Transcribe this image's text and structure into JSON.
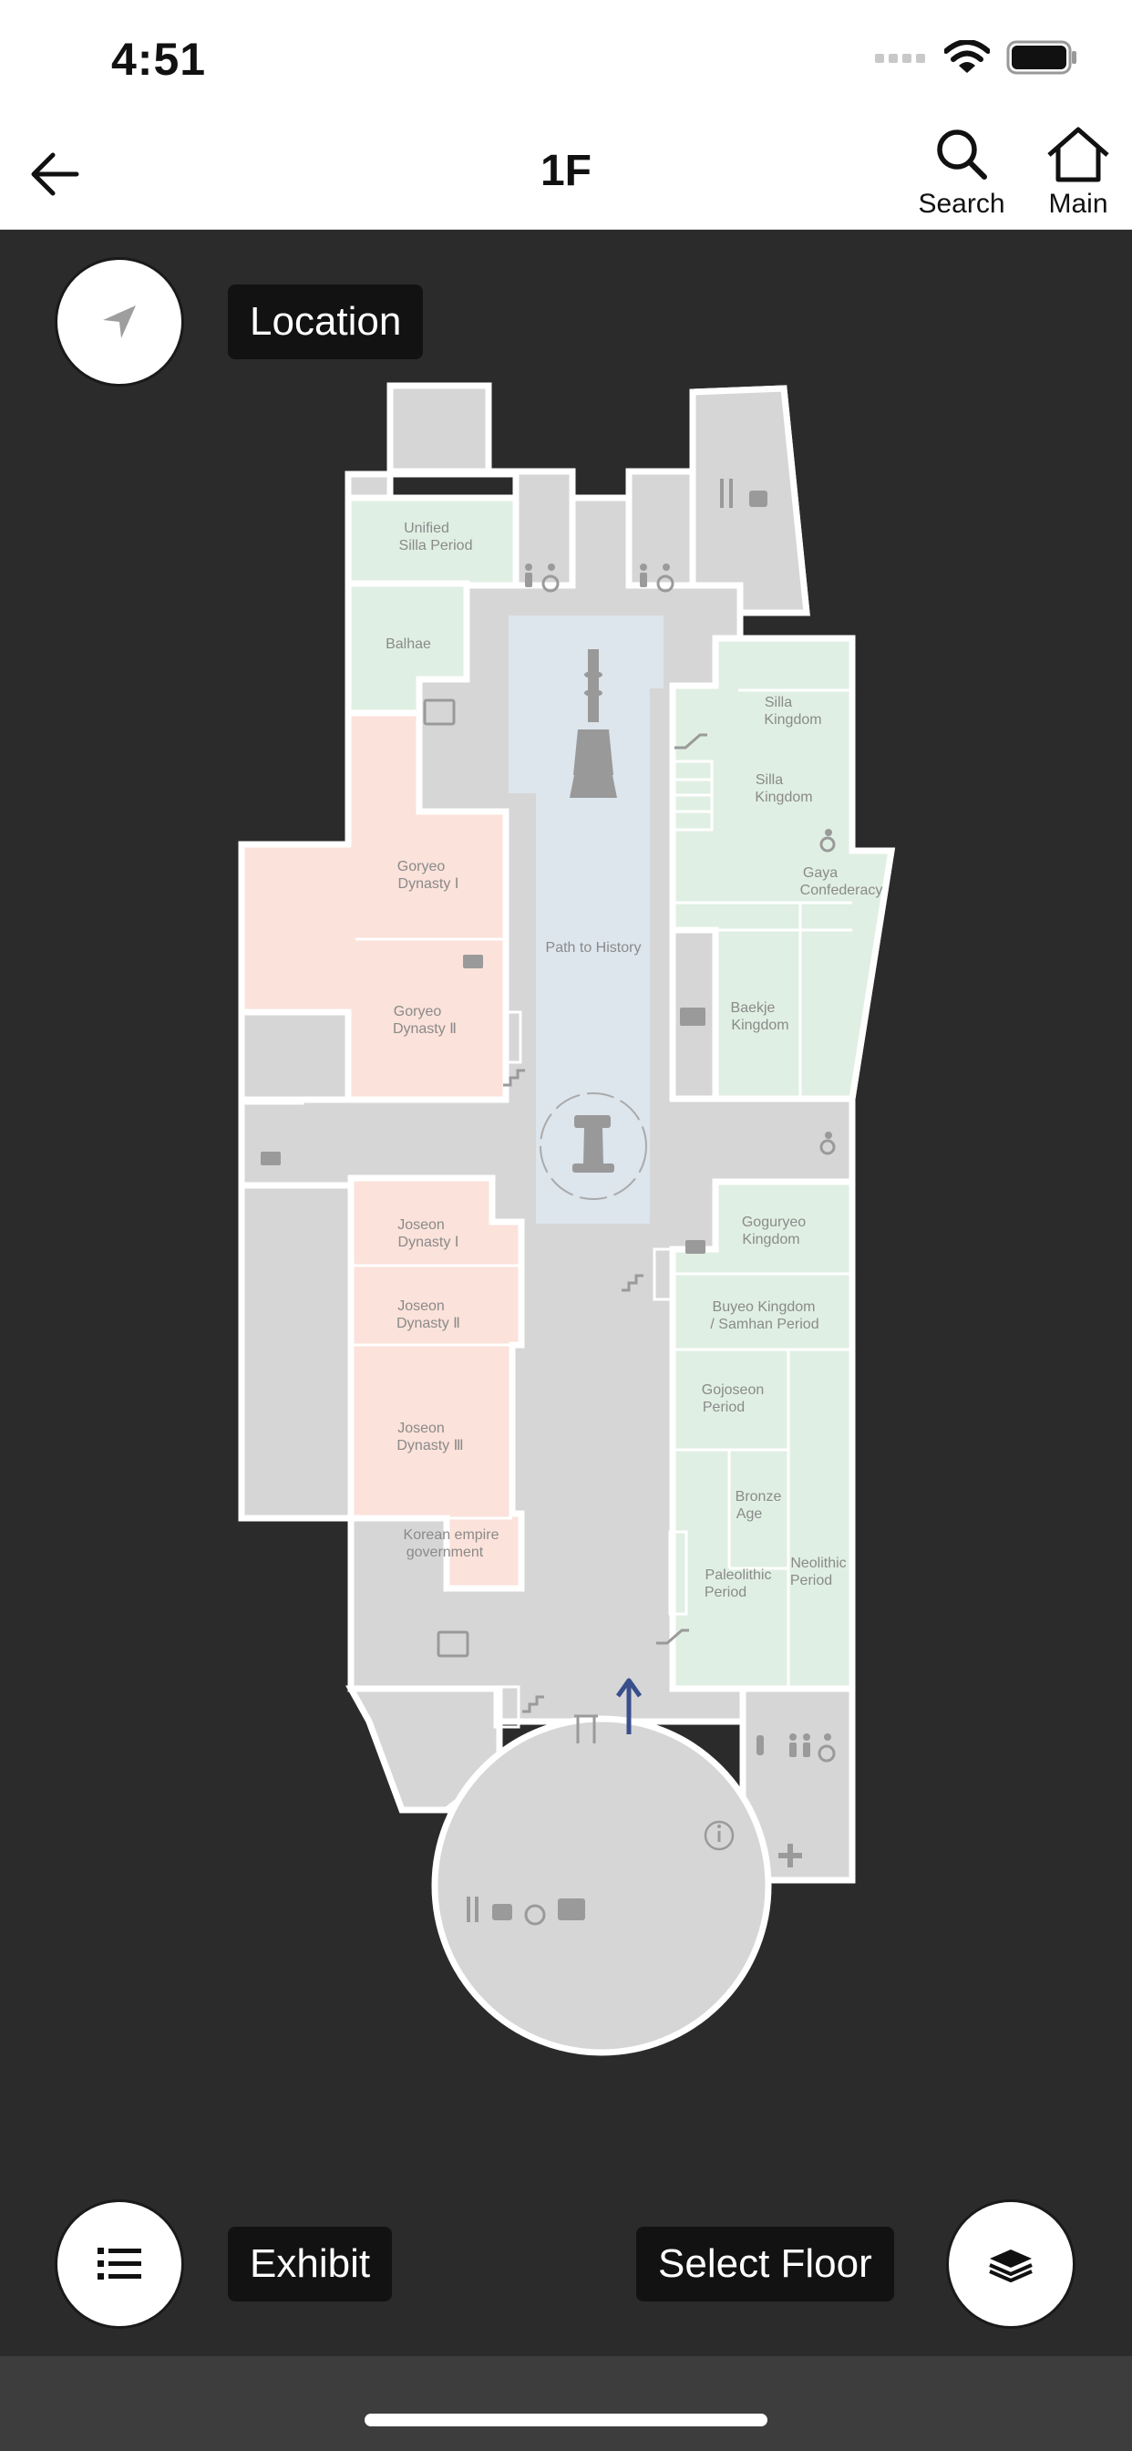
{
  "status_bar": {
    "time": "4:51"
  },
  "nav": {
    "title": "1F",
    "search_label": "Search",
    "main_label": "Main"
  },
  "controls": {
    "location_label": "Location",
    "exhibit_label": "Exhibit",
    "select_floor_label": "Select Floor"
  },
  "map": {
    "rooms": {
      "unified_silla": [
        "Unified",
        "Silla Period"
      ],
      "balhae": [
        "Balhae"
      ],
      "goryeo_1": [
        "Goryeo",
        "Dynasty Ⅰ"
      ],
      "goryeo_2": [
        "Goryeo",
        "Dynasty Ⅱ"
      ],
      "joseon_1": [
        "Joseon",
        "Dynasty Ⅰ"
      ],
      "joseon_2": [
        "Joseon",
        "Dynasty Ⅱ"
      ],
      "joseon_3": [
        "Joseon",
        "Dynasty Ⅲ"
      ],
      "korean_empire": [
        "Korean empire",
        "government"
      ],
      "path_to_history": [
        "Path to History"
      ],
      "silla_kingdom_a": [
        "Silla",
        "Kingdom"
      ],
      "silla_kingdom_b": [
        "Silla",
        "Kingdom"
      ],
      "gaya": [
        "Gaya",
        "Confederacy"
      ],
      "baekje": [
        "Baekje",
        "Kingdom"
      ],
      "goguryeo": [
        "Goguryeo",
        "Kingdom"
      ],
      "buyeo": [
        "Buyeo Kingdom",
        "/ Samhan Period"
      ],
      "gojoseon": [
        "Gojoseon",
        "Period"
      ],
      "bronze_age": [
        "Bronze",
        "Age"
      ],
      "paleolithic": [
        "Paleolithic",
        "Period"
      ],
      "neolithic": [
        "Neolithic",
        "Period"
      ]
    }
  },
  "colors": {
    "background": "#2b2b2b",
    "corridor": "#d6d6d6",
    "green_zone": "#e0efe3",
    "pink_zone": "#fbe2da",
    "blue_zone": "#dde5ed",
    "arrow": "#3a4e8c"
  },
  "icons": {
    "back": "arrow-left-icon",
    "search": "magnifier-icon",
    "main": "home-icon",
    "location": "navigation-arrow-icon",
    "exhibit": "list-icon",
    "floor": "layers-icon"
  }
}
